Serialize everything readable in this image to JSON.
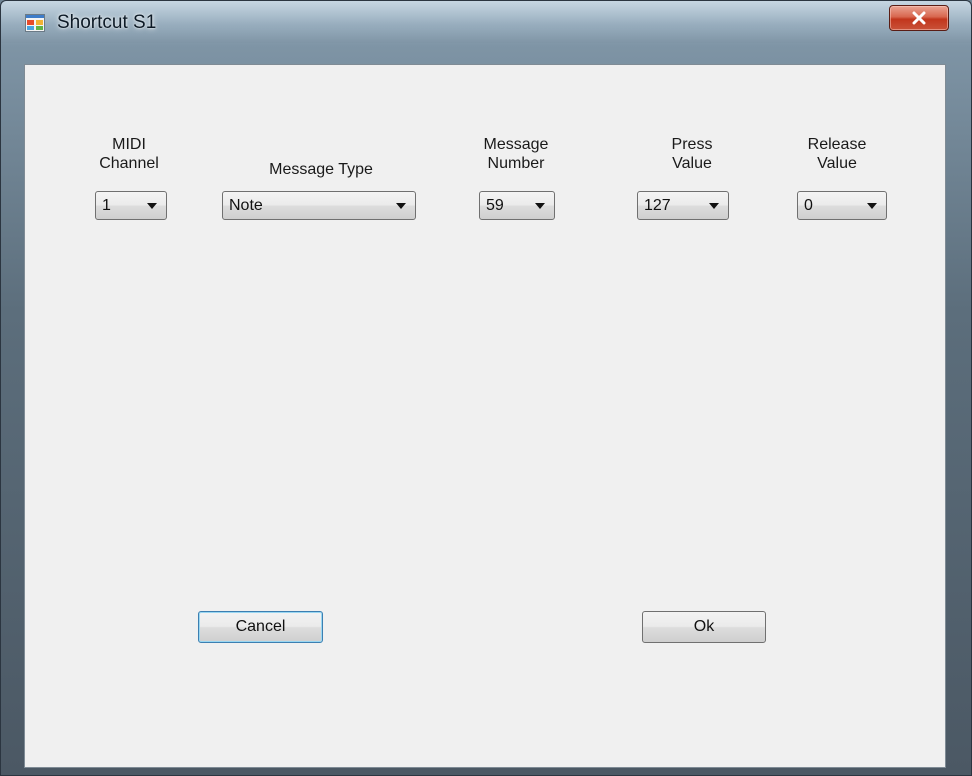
{
  "window": {
    "title": "Shortcut S1",
    "close_glyph": "x"
  },
  "icons": {
    "app": "app-icon",
    "close": "close-icon",
    "dropdown": "chevron-down-icon"
  },
  "colors": {
    "client_background": "#f0f0f0",
    "close_button": "#c8452b",
    "focus_border": "#3c7fb1"
  },
  "fields": {
    "midi_channel": {
      "label_line1": "MIDI",
      "label_line2": "Channel",
      "value": "1"
    },
    "message_type": {
      "label": "Message Type",
      "value": "Note"
    },
    "message_number": {
      "label_line1": "Message",
      "label_line2": "Number",
      "value": "59"
    },
    "press_value": {
      "label_line1": "Press",
      "label_line2": "Value",
      "value": "127"
    },
    "release_value": {
      "label_line1": "Release",
      "label_line2": "Value",
      "value": "0"
    }
  },
  "buttons": {
    "cancel": "Cancel",
    "ok": "Ok"
  }
}
